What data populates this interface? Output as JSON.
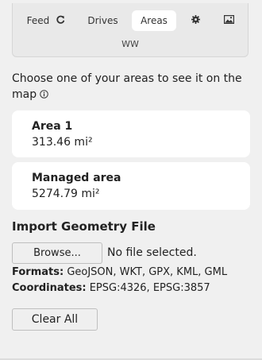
{
  "tabs": {
    "feed_label": "Feed",
    "feed_icon": "refresh-icon",
    "drives_label": "Drives",
    "areas_label": "Areas",
    "settings_icon": "gear-icon",
    "image_icon": "image-icon",
    "active": "Areas"
  },
  "panel": {
    "subtitle": "WW"
  },
  "intro": {
    "text": "Choose one of your areas to see it on the map",
    "icon": "info-icon"
  },
  "areas": [
    {
      "name": "Area 1",
      "size": "313.46 mi²"
    },
    {
      "name": "Managed area",
      "size": "5274.79 mi²"
    }
  ],
  "import": {
    "title": "Import Geometry File",
    "browse_label": "Browse...",
    "file_status": "No file selected.",
    "formats_label": "Formats:",
    "formats_value": "GeoJSON, WKT, GPX, KML, GML",
    "coordinates_label": "Coordinates:",
    "coordinates_value": "EPSG:4326, EPSG:3857"
  },
  "actions": {
    "clear_all_label": "Clear All"
  },
  "colors": {
    "background": "#f0f0f0",
    "panel": "#e9e9e9",
    "card": "#ffffff",
    "text": "#222222"
  }
}
